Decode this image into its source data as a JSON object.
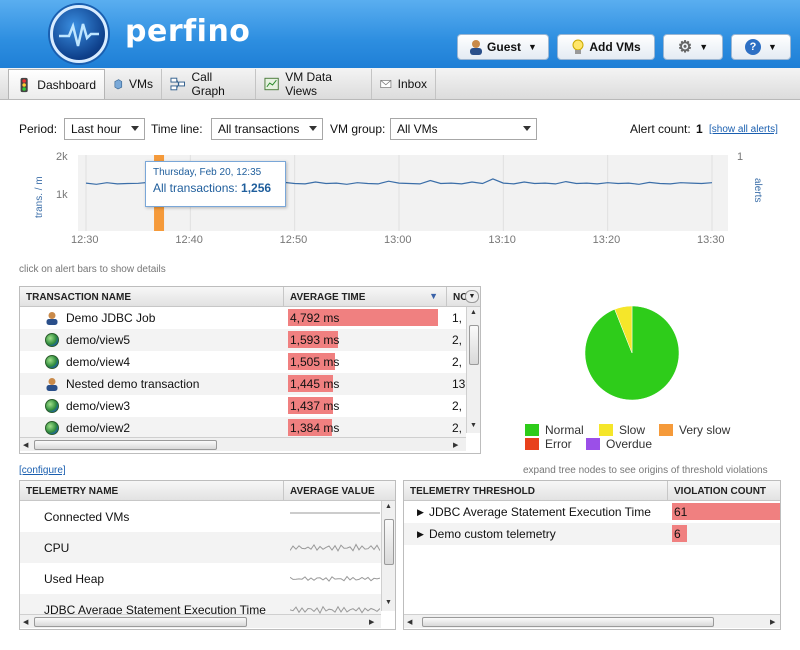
{
  "app": {
    "brand": "perfino"
  },
  "header_buttons": {
    "guest": "Guest",
    "add_vms": "Add VMs"
  },
  "tabs": [
    {
      "label": "Dashboard",
      "icon": "traffic-light-icon"
    },
    {
      "label": "VMs",
      "icon": "vm-icon"
    },
    {
      "label": "Call Graph",
      "icon": "call-graph-icon"
    },
    {
      "label": "VM Data Views",
      "icon": "data-views-icon"
    },
    {
      "label": "Inbox",
      "icon": "inbox-icon"
    }
  ],
  "filters": {
    "period_label": "Period:",
    "period_value": "Last hour",
    "timeline_label": "Time line:",
    "timeline_value": "All transactions",
    "vmgroup_label": "VM group:",
    "vmgroup_value": "All VMs",
    "alert_count_label": "Alert count:",
    "alert_count_value": "1",
    "show_all_alerts": "[show all alerts]"
  },
  "timeline_chart": {
    "y_left_ticks": [
      "2k",
      "1k"
    ],
    "y_left_label": "trans. / m",
    "y_right_tick": "1",
    "y_right_label": "alerts",
    "x_ticks": [
      "12:30",
      "12:40",
      "12:50",
      "13:00",
      "13:10",
      "13:20",
      "13:30"
    ],
    "tooltip_date": "Thursday, Feb 20, 12:35",
    "tooltip_label": "All transactions:",
    "tooltip_value": "1,256",
    "hint": "click on alert bars to show details"
  },
  "chart_data": [
    {
      "type": "line",
      "x": [
        "12:30",
        "12:31",
        "12:32",
        "12:33",
        "12:34",
        "12:35",
        "12:36",
        "12:37",
        "12:38",
        "12:39",
        "12:40",
        "12:41",
        "12:42",
        "12:43",
        "12:44",
        "12:45",
        "12:46",
        "12:47",
        "12:48",
        "12:49",
        "12:50",
        "12:51",
        "12:52",
        "12:53",
        "12:54",
        "12:55",
        "12:56",
        "12:57",
        "12:58",
        "12:59",
        "13:00",
        "13:01",
        "13:02",
        "13:03",
        "13:04",
        "13:05",
        "13:06",
        "13:07",
        "13:08",
        "13:09",
        "13:10",
        "13:11",
        "13:12",
        "13:13",
        "13:14",
        "13:15",
        "13:16",
        "13:17",
        "13:18",
        "13:19",
        "13:20",
        "13:21",
        "13:22",
        "13:23",
        "13:24",
        "13:25",
        "13:26",
        "13:27",
        "13:28",
        "13:29",
        "13:30"
      ],
      "series": [
        {
          "values": [
            1260,
            1230,
            1270,
            1240,
            1250,
            1256,
            1280,
            1240,
            1260,
            1250,
            1270,
            1230,
            1260,
            1250,
            1280,
            1240,
            1250,
            1260,
            1230,
            1280,
            1250,
            1240,
            1290,
            1250,
            1260,
            1230,
            1270,
            1250,
            1240,
            1310,
            1260,
            1250,
            1240,
            1330,
            1250,
            1260,
            1240,
            1290,
            1250,
            1370,
            1260,
            1240,
            1290,
            1250,
            1260,
            1240,
            1300,
            1250,
            1260,
            1240,
            1270,
            1250,
            1260,
            1230,
            1280,
            1250,
            1240,
            1270,
            1260,
            1250,
            1270
          ]
        }
      ],
      "ylabel": "trans. / m",
      "ylim": [
        0,
        2000
      ],
      "alerts": [
        {
          "x": "12:37",
          "count": 1
        }
      ],
      "alerts_ylim": [
        0,
        1
      ]
    },
    {
      "type": "pie",
      "categories": [
        "Normal",
        "Slow",
        "Very slow",
        "Error",
        "Overdue"
      ],
      "values": [
        94,
        6,
        0,
        0,
        0
      ],
      "colors": [
        "#2ecc1a",
        "#f5e62a",
        "#f59a3a",
        "#e8411c",
        "#9b4fe8"
      ]
    }
  ],
  "transactions": {
    "headers": [
      "TRANSACTION NAME",
      "AVERAGE TIME",
      "NO"
    ],
    "rows": [
      {
        "icon": "user-icon",
        "name": "Demo JDBC Job",
        "time": "4,792 ms",
        "ratio": 1.0,
        "count": "1,"
      },
      {
        "icon": "globe-icon",
        "name": "demo/view5",
        "time": "1,593 ms",
        "ratio": 0.33,
        "count": "2,"
      },
      {
        "icon": "globe-icon",
        "name": "demo/view4",
        "time": "1,505 ms",
        "ratio": 0.31,
        "count": "2,"
      },
      {
        "icon": "user-icon",
        "name": "Nested demo transaction",
        "time": "1,445 ms",
        "ratio": 0.3,
        "count": "13"
      },
      {
        "icon": "globe-icon",
        "name": "demo/view3",
        "time": "1,437 ms",
        "ratio": 0.3,
        "count": "2,"
      },
      {
        "icon": "globe-icon",
        "name": "demo/view2",
        "time": "1,384 ms",
        "ratio": 0.29,
        "count": "2,"
      }
    ]
  },
  "pie_legend": [
    "Normal",
    "Slow",
    "Very slow",
    "Error",
    "Overdue"
  ],
  "links": {
    "configure": "[configure]",
    "expand_hint": "expand tree nodes to see origins of threshold violations"
  },
  "telemetry": {
    "headers": [
      "TELEMETRY NAME",
      "AVERAGE VALUE"
    ],
    "rows": [
      "Connected VMs",
      "CPU",
      "Used Heap",
      "JDBC Average Statement Execution Time"
    ]
  },
  "thresholds": {
    "headers": [
      "TELEMETRY THRESHOLD",
      "VIOLATION COUNT"
    ],
    "rows": [
      {
        "name": "JDBC Average Statement Execution Time",
        "count": "61",
        "ratio": 1.0
      },
      {
        "name": "Demo custom telemetry",
        "count": "6",
        "ratio": 0.14
      }
    ]
  },
  "colors": {
    "accent": "#2d8ee0",
    "bar": "#f08080",
    "line": "#3b6ea8",
    "alert": "#f59a3a"
  }
}
